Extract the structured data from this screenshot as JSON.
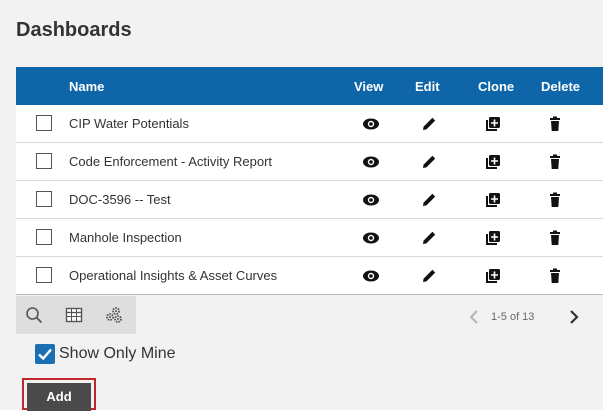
{
  "header": {
    "title": "Dashboards"
  },
  "table": {
    "columns": {
      "name": "Name",
      "view": "View",
      "edit": "Edit",
      "clone": "Clone",
      "delete": "Delete"
    },
    "rows": [
      {
        "name": "CIP Water Potentials",
        "checked": false
      },
      {
        "name": "Code Enforcement - Activity Report",
        "checked": false
      },
      {
        "name": "DOC-3596 -- Test",
        "checked": false
      },
      {
        "name": "Manhole Inspection",
        "checked": false
      },
      {
        "name": "Operational Insights & Asset Curves",
        "checked": false
      }
    ],
    "icons": {
      "view": "eye-icon",
      "edit": "pencil-icon",
      "clone": "clone-icon",
      "delete": "trash-icon"
    }
  },
  "toolbar": {
    "icons": [
      "search-icon",
      "grid-icon",
      "gears-icon"
    ]
  },
  "pagination": {
    "text": "1-5 of 13"
  },
  "filter": {
    "show_only_mine_label": "Show Only Mine",
    "show_only_mine_checked": true
  },
  "actions": {
    "add_label": "Add"
  },
  "colors": {
    "header": "#0e66a8",
    "checkbox_checked": "#1b6fb3",
    "add_button": "#4a4a4a",
    "highlight": "#c0272d"
  }
}
